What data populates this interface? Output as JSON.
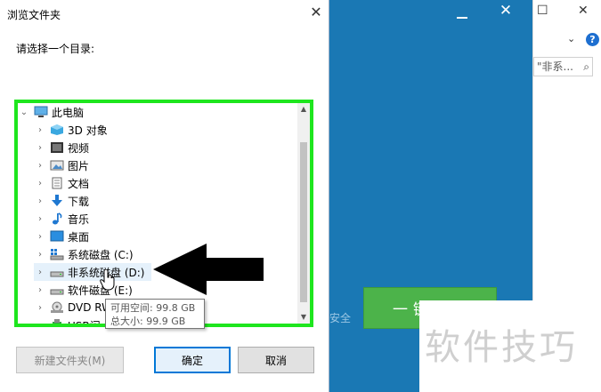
{
  "dialog": {
    "title": "浏览文件夹",
    "prompt": "请选择一个目录:",
    "tree": {
      "items": [
        {
          "label": "此电脑",
          "icon": "computer-icon"
        },
        {
          "label": "3D 对象",
          "icon": "3d-objects-icon"
        },
        {
          "label": "视频",
          "icon": "video-icon"
        },
        {
          "label": "图片",
          "icon": "pictures-icon"
        },
        {
          "label": "文档",
          "icon": "documents-icon"
        },
        {
          "label": "下载",
          "icon": "download-icon"
        },
        {
          "label": "音乐",
          "icon": "music-icon"
        },
        {
          "label": "桌面",
          "icon": "desktop-icon"
        },
        {
          "label": "系统磁盘 (C:)",
          "icon": "system-drive-icon"
        },
        {
          "label": "非系统磁盘 (D:)",
          "icon": "drive-icon"
        },
        {
          "label": "软件磁盘 (E:)",
          "icon": "drive-icon"
        },
        {
          "label": "DVD RW",
          "icon": "dvd-drive-icon"
        },
        {
          "label": "USB闪",
          "icon": "usb-drive-icon"
        }
      ]
    },
    "tooltip": {
      "free_space": "可用空间: 99.8 GB",
      "total_size": "总大小: 99.9 GB"
    },
    "buttons": {
      "new_folder": "新建文件夹(M)",
      "ok": "确定",
      "cancel": "取消"
    }
  },
  "installer": {
    "install_button": "一键安装",
    "safe_text": "安全"
  },
  "explorer": {
    "search_placeholder": "\"非系...",
    "help_label": "?"
  },
  "watermark": "软件技巧",
  "colors": {
    "highlight_border": "#1ee61e",
    "installer_blue": "#1a78b4",
    "install_green": "#4cb34a"
  }
}
